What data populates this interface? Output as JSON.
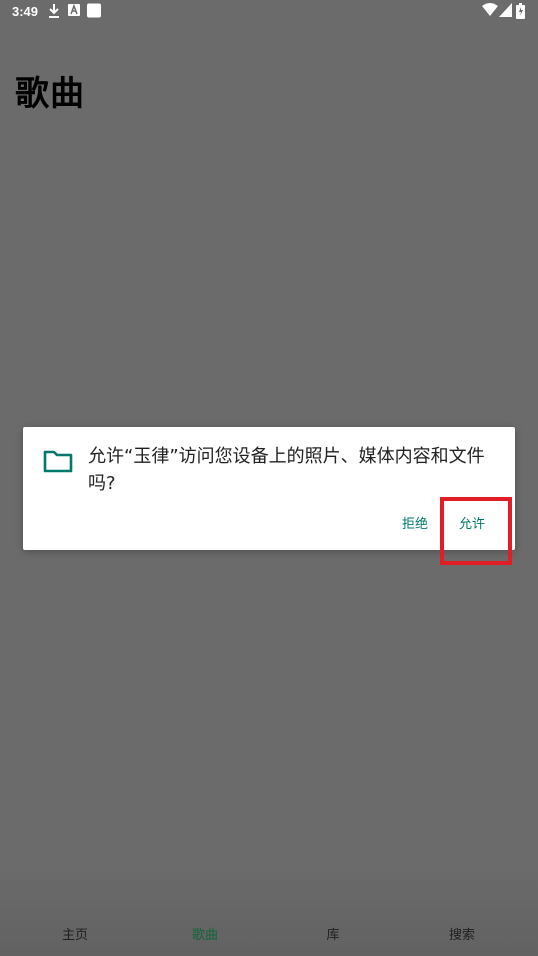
{
  "status_bar": {
    "time": "3:49",
    "icons": [
      "download-icon",
      "a-notification-icon",
      "square-notification-icon",
      "wifi-icon",
      "signal-icon",
      "battery-icon"
    ]
  },
  "page": {
    "title": "歌曲"
  },
  "dialog": {
    "message": "允许“玉律”访问您设备上的照片、媒体内容和文件吗?",
    "deny_label": "拒绝",
    "allow_label": "允许",
    "accent_color": "#00796b",
    "highlight_color": "#e21d26"
  },
  "bottom_nav": {
    "items": [
      {
        "label": "主页"
      },
      {
        "label": "歌曲"
      },
      {
        "label": "库"
      },
      {
        "label": "搜索"
      }
    ],
    "active_color": "#14643a"
  }
}
